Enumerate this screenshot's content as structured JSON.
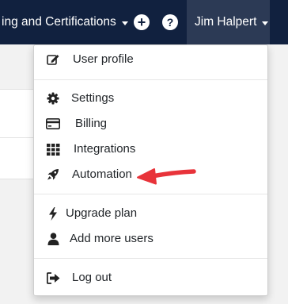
{
  "topbar": {
    "training_label": "ing and Certifications",
    "user_name": "Jim Halpert"
  },
  "menu": {
    "items": [
      {
        "label": "User profile",
        "icon": "edit-icon"
      },
      {
        "label": "Settings",
        "icon": "gear-icon"
      },
      {
        "label": "Billing",
        "icon": "credit-card-icon"
      },
      {
        "label": "Integrations",
        "icon": "grid-icon"
      },
      {
        "label": "Automation",
        "icon": "rocket-icon"
      },
      {
        "label": "Upgrade plan",
        "icon": "bolt-icon"
      },
      {
        "label": "Add more users",
        "icon": "user-icon"
      },
      {
        "label": "Log out",
        "icon": "sign-out-icon"
      }
    ]
  },
  "colors": {
    "topbar": "#11213f",
    "user_menu": "#2c3a55",
    "arrow": "#e8333a"
  }
}
